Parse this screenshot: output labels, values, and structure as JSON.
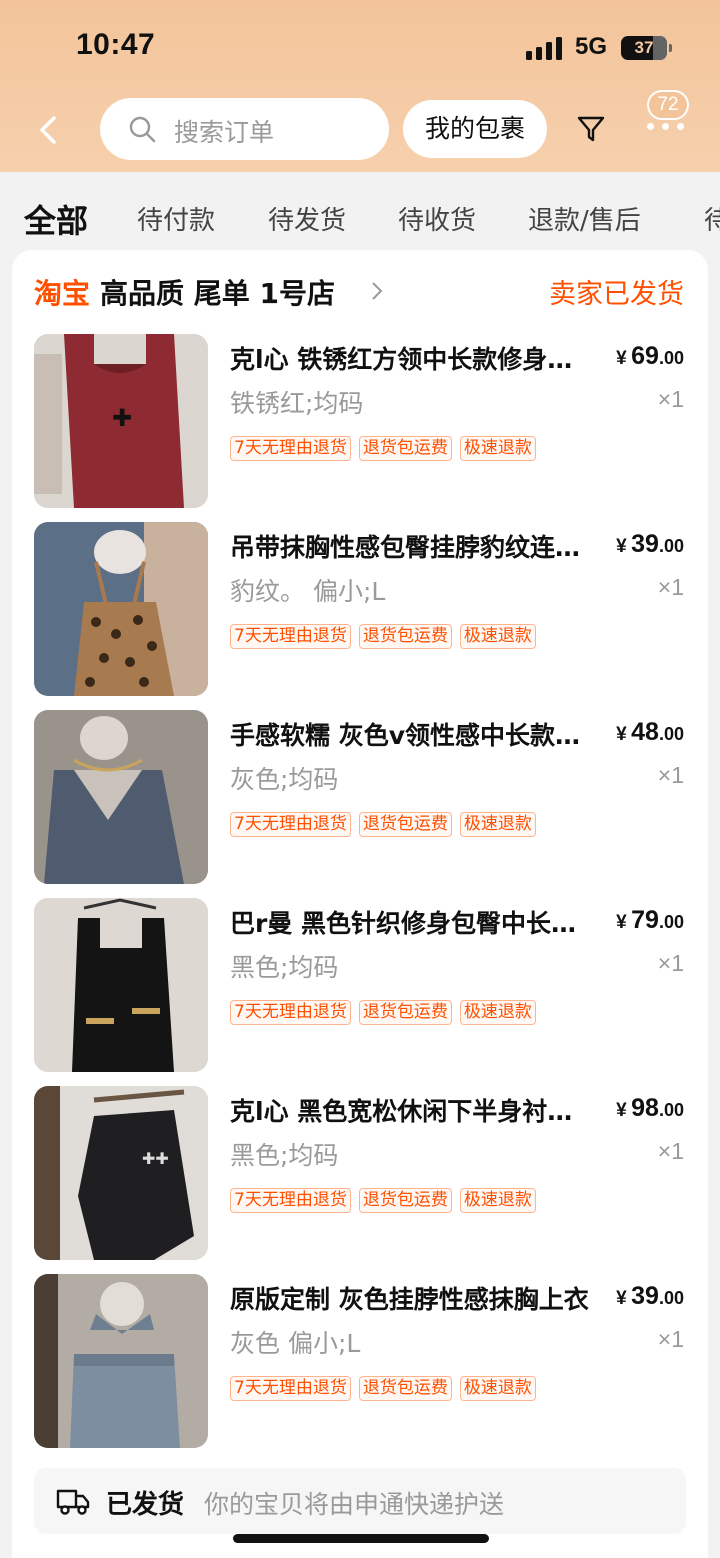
{
  "status_bar": {
    "time": "10:47",
    "network": "5G",
    "battery": "37"
  },
  "header": {
    "search_placeholder": "搜索订单",
    "my_packages": "我的包裹",
    "notification_count": "72"
  },
  "tabs": [
    {
      "label": "全部",
      "active": true
    },
    {
      "label": "待付款"
    },
    {
      "label": "待发货"
    },
    {
      "label": "待收货"
    },
    {
      "label": "退款/售后"
    },
    {
      "label": "待"
    }
  ],
  "order": {
    "platform_logo": "淘宝",
    "shop_name": "高品质 尾单 1号店",
    "status": "卖家已发货",
    "items": [
      {
        "title": "克l心 铁锈红方领中长款修身包臀吊带连衣裙",
        "sku": "铁锈红;均码",
        "price_currency": "¥",
        "price_int": "69",
        "price_dec": ".00",
        "qty": "×1"
      },
      {
        "title": "吊带抹胸性感包臀挂脖豹纹连衣裙",
        "sku": "豹纹。 偏小;L",
        "price_currency": "¥",
        "price_int": "39",
        "price_dec": ".00",
        "qty": "×1"
      },
      {
        "title": "手感软糯 灰色v领性感中长款针织连衣裙",
        "sku": "灰色;均码",
        "price_currency": "¥",
        "price_int": "48",
        "price_dec": ".00",
        "qty": "×1"
      },
      {
        "title": "巴r曼 黑色针织修身包臀中长款连衣裙",
        "sku": "黑色;均码",
        "price_currency": "¥",
        "price_int": "79",
        "price_dec": ".00",
        "qty": "×1"
      },
      {
        "title": "克l心 黑色宽松休闲下半身衬衫外套",
        "sku": "黑色;均码",
        "price_currency": "¥",
        "price_int": "98",
        "price_dec": ".00",
        "qty": "×1"
      },
      {
        "title": "原版定制 灰色挂脖性感抹胸上衣",
        "sku": "灰色 偏小;L",
        "price_currency": "¥",
        "price_int": "39",
        "price_dec": ".00",
        "qty": "×1"
      }
    ],
    "tags": [
      "7天无理由退货",
      "退货包运费",
      "极速退款"
    ],
    "shipping": {
      "status": "已发货",
      "description": "你的宝贝将由申通快递护送"
    }
  },
  "colors": {
    "accent": "#ff5000",
    "header_bg": "#f3c49a"
  },
  "icons": [
    "back-icon",
    "search-icon",
    "filter-icon",
    "more-icon",
    "chevron-right-icon",
    "truck-icon"
  ]
}
